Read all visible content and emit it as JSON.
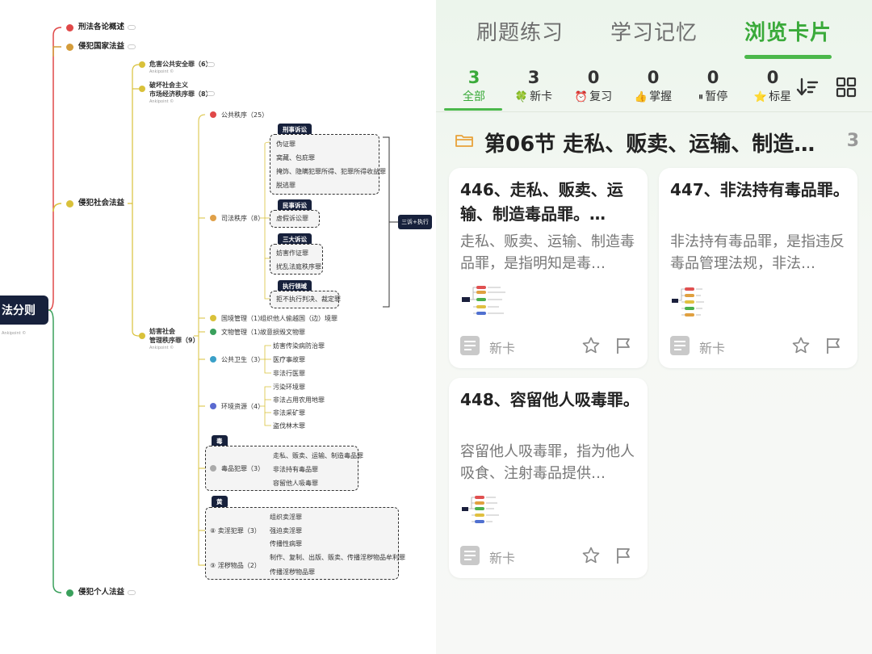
{
  "mindmap": {
    "root": "法分则",
    "root_sub": "Ankipoint ©",
    "branch_shiyong": "刑法各论概述",
    "branch_guojia": "侵犯国家法益",
    "branch_shehui": "侵犯社会法益",
    "branch_geren": "侵犯个人法益",
    "n_gonggong_anquan": "危害公共安全罪（6）",
    "n_pohuai_1": "破坏社会主义",
    "n_pohuai_2": "市场经济秩序罪（8）",
    "n_fanghai_1": "妨害社会",
    "n_fanghai_2": "管理秩序罪（9）",
    "sub_label": "Ankipoint ©",
    "c_gonggong_zhixu": "公共秩序（25）",
    "c_sifa_zhixu": "司法秩序（8）",
    "c_guojing": "国境管理（1）",
    "c_wenwu": "文物管理（1）",
    "c_weisheng": "公共卫生（3）",
    "c_huanjing": "环境资源（4）",
    "c_dupin": "毒品犯罪（3）",
    "c_maiyin": "⑧ 卖淫犯罪（3）",
    "c_yinhui": "⑨ 淫秽物品（2）",
    "tag_xingshi": "刑事诉讼",
    "tag_minshi": "民事诉讼",
    "tag_sanda": "三大诉讼",
    "tag_zhixing": "执行领域",
    "tag_du": "毒",
    "tag_huang": "黄",
    "l_weizheng": "伪证罪",
    "l_wocang": "窝藏、包庇罪",
    "l_yanshi": "掩饰、隐瞒犯罪所得、犯罪所得收益罪",
    "l_tuotao": "脱逃罪",
    "l_xujia": "虚假诉讼罪",
    "l_fanghai_zuozheng": "妨害作证罪",
    "l_raoluan": "扰乱法庭秩序罪",
    "l_jubu": "拒不执行判决、裁定罪",
    "l_zuzhi_touyue": "组织他人偷越国（边）境罪",
    "l_gu_wenhua": "故意损毁文物罪",
    "l_chuanran": "妨害传染病防治罪",
    "l_yiliao": "医疗事故罪",
    "l_feifa_xingyi": "非法行医罪",
    "l_wuran": "污染环境罪",
    "l_zhanyong": "非法占用农用地罪",
    "l_caikuang": "非法采矿罪",
    "l_daofa": "盗伐林木罪",
    "l_zousi": "走私、贩卖、运输、制造毒品罪",
    "l_chiyou": "非法持有毒品罪",
    "l_rongliu": "容留他人吸毒罪",
    "l_zuzhi_maiyin": "组织卖淫罪",
    "l_qiangpo": "强迫卖淫罪",
    "l_chuanbo_xingbing": "传播性病罪",
    "l_zhizuo": "制作、复制、出版、贩卖、传播淫秽物品牟利罪",
    "l_chuanbo_yinhui": "传播淫秽物品罪",
    "bracket_label": "三诉+执行"
  },
  "app": {
    "tabs": [
      {
        "label": "刷题练习"
      },
      {
        "label": "学习记忆"
      },
      {
        "label": "浏览卡片"
      }
    ],
    "active_tab": 2,
    "filters": [
      {
        "count": "3",
        "icon": "",
        "label": "全部"
      },
      {
        "count": "3",
        "icon": "🍀",
        "label": "新卡"
      },
      {
        "count": "0",
        "icon": "⏰",
        "label": "复习"
      },
      {
        "count": "0",
        "icon": "👍",
        "label": "掌握"
      },
      {
        "count": "0",
        "icon": "⏸",
        "label": "暂停"
      },
      {
        "count": "0",
        "icon": "⭐",
        "label": "标星"
      }
    ],
    "tool_icons": [
      "sort-icon",
      "grid-icon"
    ],
    "section": {
      "title": "第06节 走私、贩卖、运输、制造…",
      "count": "3"
    },
    "cards": [
      {
        "title": "446、走私、贩卖、运输、制造毒品罪。…",
        "desc": "走私、贩卖、运输、制造毒品罪，是指明知是毒…",
        "status": "新卡"
      },
      {
        "title": "447、非法持有毒品罪。",
        "desc": "非法持有毒品罪，是指违反毒品管理法规，非法…",
        "status": "新卡"
      },
      {
        "title": "448、容留他人吸毒罪。",
        "desc": "容留他人吸毒罪，指为他人吸食、注射毒品提供…",
        "status": "新卡"
      }
    ],
    "colors": {
      "accent": "#3aaa3a",
      "muted": "#999999"
    }
  }
}
